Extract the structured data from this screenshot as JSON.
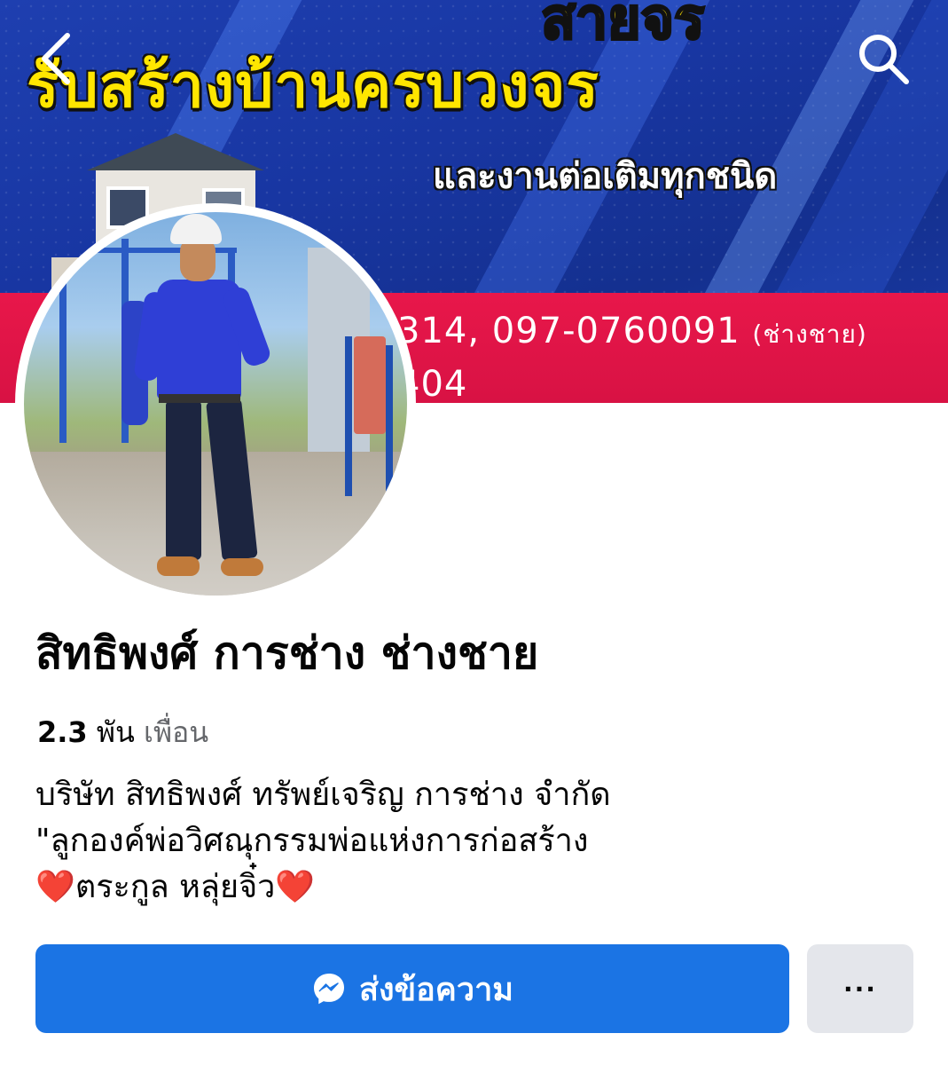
{
  "cover": {
    "headline_top": "สายจร",
    "headline": "รับสร้างบ้านครบวงจร",
    "subline": "และงานต่อเติมทุกชนิด",
    "phone_line1": "314, 097-0760091",
    "phone_line1_suffix": "(ช่างชาย)",
    "phone_line2": "404"
  },
  "nav": {
    "back_icon": "chevron-left-icon",
    "search_icon": "search-icon"
  },
  "profile": {
    "name": "สิทธิพงศ์ การช่าง ช่างชาย",
    "friends_count": "2.3",
    "friends_unit": "พัน",
    "friends_label": "เพื่อน",
    "bio_line1": "บริษัท สิทธิพงศ์ ทรัพย์เจริญ การช่าง จำกัด",
    "bio_line2": "\"ลูกองค์พ่อวิศณุกรรมพ่อแห่งการก่อสร้าง",
    "bio_heart_left": "❤️",
    "bio_line3": "ตระกูล หลุ่ยจิ๋ว",
    "bio_heart_right": "❤️"
  },
  "actions": {
    "message_label": "ส่งข้อความ",
    "message_icon": "messenger-icon",
    "more_label": "···"
  },
  "colors": {
    "primary": "#1b74e4",
    "secondary_button": "#e4e6eb",
    "text": "#050505",
    "muted_text": "#65676b"
  }
}
